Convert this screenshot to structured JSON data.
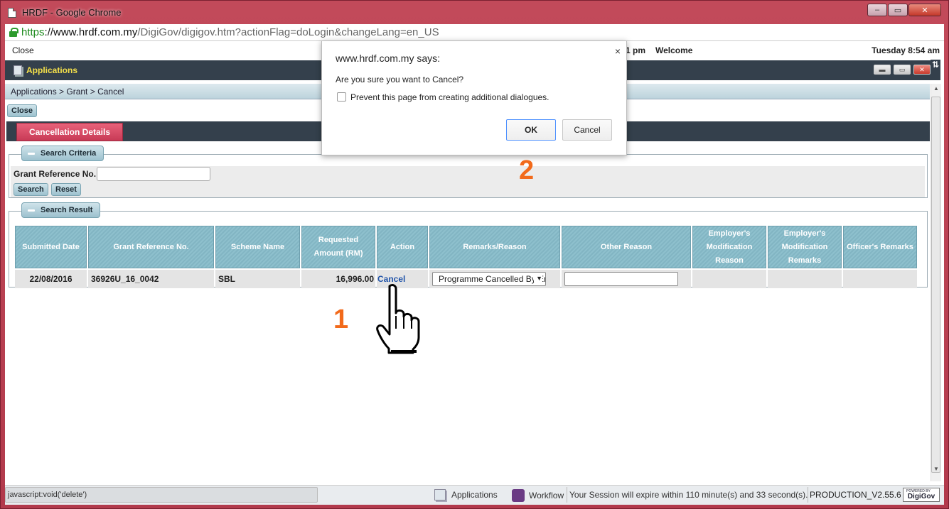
{
  "browser": {
    "window_title": "HRDF - Google Chrome",
    "url_scheme": "https",
    "url_host": "://www.hrdf.com.my",
    "url_path": "/DigiGov/digigov.htm?actionFlag=doLogin&changeLang=en_US",
    "win_minimize": "‒",
    "win_restore": "▭",
    "win_close": "✕"
  },
  "app": {
    "top_close": "Close",
    "top_partial_time": "1 pm",
    "top_welcome": "Welcome",
    "top_datetime": "Tuesday 8:54 am",
    "appbar_label": "Applications",
    "breadcrumb": "Applications  > Grant  > Cancel",
    "close_button": "Close",
    "tab_label": "Cancellation Details"
  },
  "search_criteria": {
    "legend": "Search Criteria",
    "field_label": "Grant Reference No.",
    "field_value": "",
    "search_button": "Search",
    "reset_button": "Reset"
  },
  "search_result": {
    "legend": "Search Result",
    "columns": [
      "Submitted Date",
      "Grant Reference No.",
      "Scheme Name",
      "Requested Amount (RM)",
      "Action",
      "Remarks/Reason",
      "Other Reason",
      "Employer's Modification Reason",
      "Employer's Modification Remarks",
      "Officer's Remarks"
    ],
    "rows": [
      {
        "submitted_date": "22/08/2016",
        "grant_ref": "36926U_16_0042",
        "scheme": "SBL",
        "amount": "16,996.00",
        "action": "Cancel",
        "remarks_selected": "Programme Cancelled By Employer",
        "other_reason": "",
        "emp_mod_reason": "",
        "emp_mod_remarks": "",
        "officer_remarks": ""
      }
    ]
  },
  "dialog": {
    "title": "www.hrdf.com.my says:",
    "message": "Are you sure you want to Cancel?",
    "checkbox_label": "Prevent this page from creating additional dialogues.",
    "ok_label": "OK",
    "cancel_label": "Cancel",
    "close_glyph": "×"
  },
  "annotations": {
    "step1": "1",
    "step2": "2",
    "color": "#f26a1b"
  },
  "statusbar": {
    "link_preview": "javascript:void('delete')",
    "applications": "Applications",
    "workflow": "Workflow",
    "session": "Your Session will expire within 110 minute(s) and 33 second(s).",
    "version": "PRODUCTION_V2.55.6",
    "logo_text": "DigiGov",
    "logo_small": "POWERED BY"
  }
}
